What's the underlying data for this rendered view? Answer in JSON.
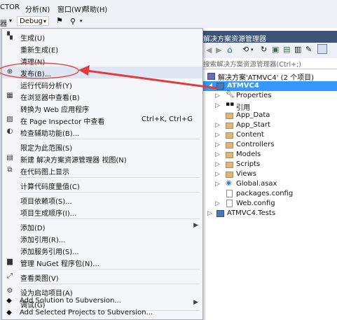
{
  "menubar": {
    "items": [
      "CTOR",
      "分析(N)",
      "窗口(W)",
      "帮助(H)"
    ]
  },
  "toolbar": {
    "left_fragment": "器",
    "config_value": "Debug"
  },
  "context_menu": {
    "items": [
      {
        "label": "生成(U)",
        "icon": "build-icon"
      },
      {
        "label": "重新生成(E)",
        "icon": ""
      },
      {
        "label": "清理(N)",
        "icon": ""
      },
      {
        "label": "发布(B)...",
        "icon": "globe-icon"
      },
      {
        "label": "运行代码分析(Y)",
        "icon": ""
      },
      {
        "label": "在浏览器中查看(B)",
        "icon": "browser-icon"
      },
      {
        "label": "转换为 Web 应用程序",
        "icon": ""
      },
      {
        "label": "在 Page Inspector 中查看",
        "shortcut": "Ctrl+K, Ctrl+G",
        "icon": "inspector-icon"
      },
      {
        "label": "检查辅助功能(B)...",
        "icon": "accessibility-icon"
      },
      {
        "label": "限定为此范围(S)",
        "icon": ""
      },
      {
        "label": "新建 解决方案资源管理器 视图(N)",
        "icon": "new-view-icon"
      },
      {
        "label": "在代码图上显示",
        "icon": "code-map-icon"
      },
      {
        "label": "计算代码度量值(C)",
        "icon": ""
      },
      {
        "label": "项目依赖项(S)...",
        "icon": ""
      },
      {
        "label": "项目生成顺序(I)...",
        "icon": ""
      },
      {
        "label": "添加(D)",
        "icon": "",
        "submenu": true
      },
      {
        "label": "添加引用(R)...",
        "icon": ""
      },
      {
        "label": "添加服务引用(S)...",
        "icon": ""
      },
      {
        "label": "管理 NuGet 程序包(N)...",
        "icon": "nuget-icon"
      },
      {
        "label": "查看类图(V)",
        "icon": "class-diagram-icon"
      },
      {
        "label": "设为启动项目(A)",
        "icon": "gear-icon"
      },
      {
        "label": "调试(G)",
        "icon": "",
        "submenu": true
      },
      {
        "label": "Add Solution to Subversion...",
        "icon": "svn-icon"
      },
      {
        "label": "Add Selected Projects to Subversion...",
        "icon": "svn-icon"
      }
    ]
  },
  "solution_explorer": {
    "title": "解决方案资源管理器",
    "search_placeholder": "搜索解决方案资源管理器(Ctrl+;)",
    "solution_label": "解决方案'ATMVC4' (2 个项目)",
    "project_label": "ATMVC4",
    "children": [
      "Properties",
      "引用",
      "App_Data",
      "App_Start",
      "Content",
      "Controllers",
      "Models",
      "Scripts",
      "Views",
      "Global.asax",
      "packages.config",
      "Web.config"
    ],
    "other_project": "ATMVC4.Tests"
  },
  "annotation": {
    "ellipse_color": "#d9534f",
    "arrow_color": "#e03c3c"
  }
}
